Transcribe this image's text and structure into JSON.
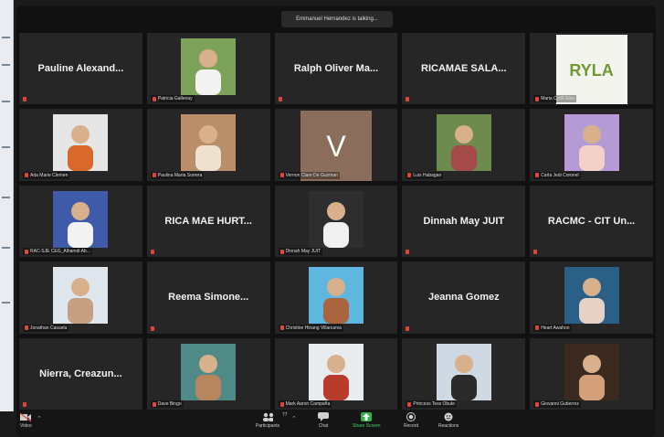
{
  "banner": "Emmanuel Hernandez is talking...",
  "tiles": [
    {
      "name": "Pauline Alexand...",
      "kind": "name"
    },
    {
      "name": "Patricia Gallenay",
      "kind": "photo",
      "bg": "#7da35a",
      "fg": "#f3f3f3"
    },
    {
      "name": "Ralph Oliver Ma...",
      "kind": "name"
    },
    {
      "name": "RICAMAE SALA...",
      "kind": "name"
    },
    {
      "name": "Maria Cyrill Ginu",
      "kind": "logo",
      "logo_text": "RYLA"
    },
    {
      "name": "Ada Marie Clemen",
      "kind": "photo",
      "bg": "#e6e6e6",
      "fg": "#d9692a"
    },
    {
      "name": "Paulina Maria Sorrera",
      "kind": "photo",
      "bg": "#b98f6a",
      "fg": "#efe1cf"
    },
    {
      "name": "Vernon Clare De Guzman",
      "kind": "letter",
      "letter": "V",
      "bg": "#8a6d5b"
    },
    {
      "name": "Luis Habagan",
      "kind": "photo",
      "bg": "#6e8b4d",
      "fg": "#a44a4a"
    },
    {
      "name": "Carla Jedi Coronel",
      "kind": "photo",
      "bg": "#b59bd6",
      "fg": "#f3d1c8"
    },
    {
      "name": "RAC-SJE CEG_Alhamdi Ab...",
      "kind": "photo",
      "bg": "#3f5aa8",
      "fg": "#f2f2f2"
    },
    {
      "name": "RICA MAE HURT...",
      "kind": "name"
    },
    {
      "name": "Dinnah May JUIT",
      "kind": "photo",
      "bg": "#2e2e2e",
      "fg": "#f1f1f1"
    },
    {
      "name": "Dinnah May JUIT",
      "kind": "name"
    },
    {
      "name": "RACMC - CIT Un...",
      "kind": "name"
    },
    {
      "name": "Jonathan Casuela",
      "kind": "photo",
      "bg": "#dfe6ee",
      "fg": "#c7a083"
    },
    {
      "name": "Reema Simone...",
      "kind": "name"
    },
    {
      "name": "Christine Hinang Villanueva",
      "kind": "photo",
      "bg": "#5fb7e0",
      "fg": "#a8643e"
    },
    {
      "name": "Jeanna Gomez",
      "kind": "name"
    },
    {
      "name": "Heart Awahon",
      "kind": "photo",
      "bg": "#2a5f86",
      "fg": "#e7d2c6"
    },
    {
      "name": "Nierra, Creazun...",
      "kind": "name"
    },
    {
      "name": "Dave Bingo",
      "kind": "photo",
      "bg": "#4f8a87",
      "fg": "#b7855e"
    },
    {
      "name": "Mark Aaron Campaña",
      "kind": "photo",
      "bg": "#e9ecef",
      "fg": "#b83b2b"
    },
    {
      "name": "Princess Tess Obule",
      "kind": "photo",
      "bg": "#cfd9e3",
      "fg": "#2a2a2a"
    },
    {
      "name": "Giovanni Gutierrez",
      "kind": "photo",
      "bg": "#3b2a20",
      "fg": "#d3a07a"
    }
  ],
  "toolbar": {
    "video": "Video",
    "participants": "Participants",
    "participants_count": "77",
    "chat": "Chat",
    "share": "Share Screen",
    "record": "Record",
    "reactions": "Reactions"
  },
  "colors": {
    "mic_muted": "#e0453a",
    "share_green": "#2fb24c"
  }
}
